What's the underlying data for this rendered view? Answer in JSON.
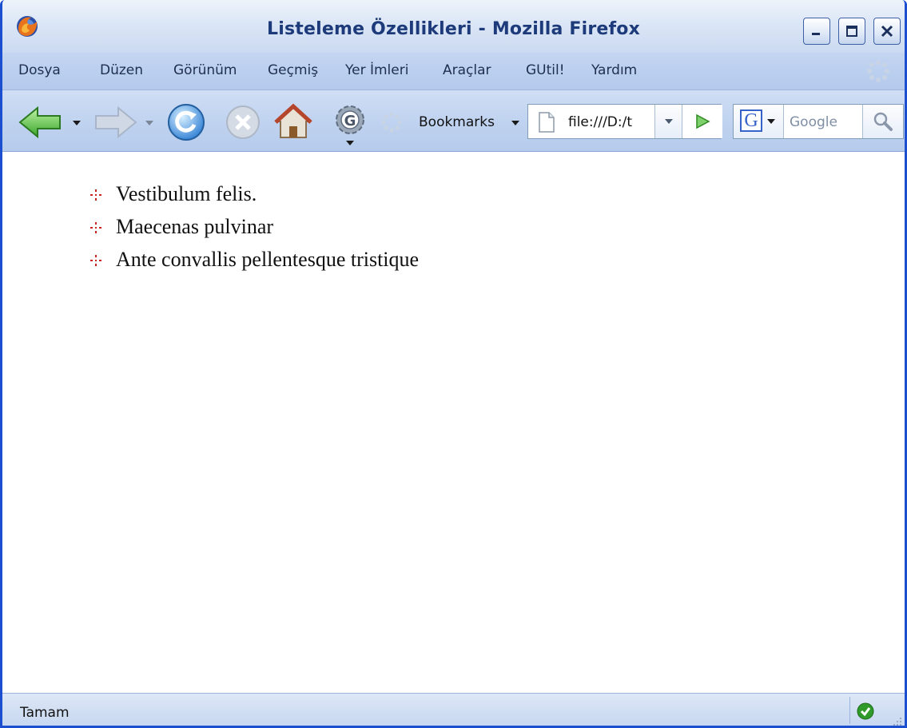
{
  "window": {
    "title": "Listeleme Özellikleri - Mozilla Firefox"
  },
  "menu": {
    "items": [
      "Dosya",
      "Düzen",
      "Görünüm",
      "Geçmiş",
      "Yer İmleri",
      "Araçlar",
      "GUtil!",
      "Yardım"
    ]
  },
  "toolbar": {
    "bookmarks_label": "Bookmarks",
    "url": "file:///D:/t",
    "search_placeholder": "Google",
    "search_engine_letter": "G"
  },
  "content": {
    "list_items": [
      "Vestibulum felis.",
      "Maecenas pulvinar",
      "Ante convallis pellentesque tristique"
    ],
    "bullet_color": "#cc2222"
  },
  "status": {
    "text": "Tamam"
  },
  "colors": {
    "title_text": "#1d3b7a",
    "window_border": "#1b4fd0",
    "menubar_bg": "#c3d5f1"
  }
}
